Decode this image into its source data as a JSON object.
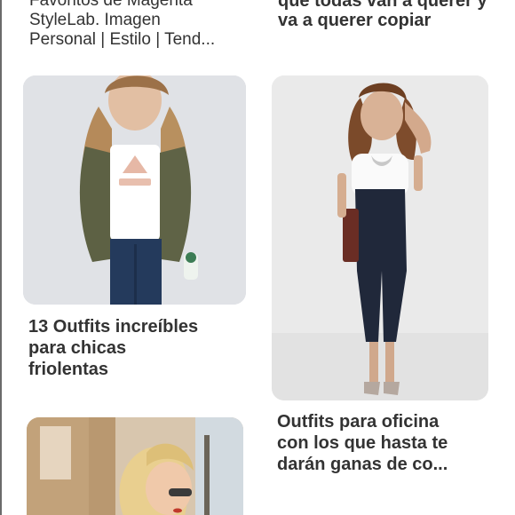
{
  "feed": {
    "top_left_caption_lines": [
      "Favoritos de Magenta",
      "StyleLab. Imagen",
      "Personal | Estilo | Tend..."
    ],
    "top_right_caption_lines": [
      "que todas van a querer y",
      "va a querer copiar"
    ],
    "pins": [
      {
        "title_lines": [
          "13 Outfits increíbles",
          "para chicas",
          "friolentas"
        ]
      },
      {
        "title_lines": [
          "Outfits para oficina",
          "con los que hasta te",
          "darán ganas de co..."
        ]
      },
      {
        "title_lines": []
      }
    ],
    "colors": {
      "text": "#333333",
      "background": "#ffffff"
    }
  }
}
